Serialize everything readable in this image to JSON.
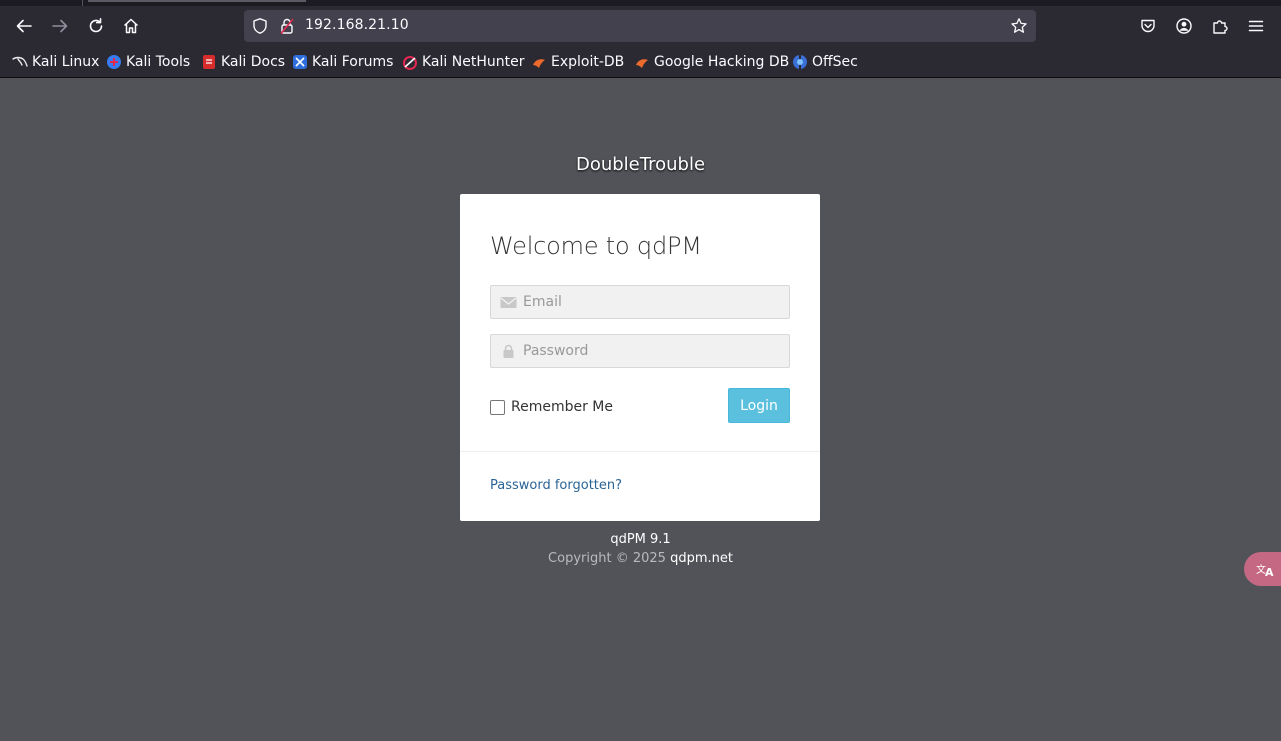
{
  "browser": {
    "url": "192.168.21.10",
    "bookmarks": [
      {
        "label": "Kali Linux",
        "icon": "kali-dragon-icon"
      },
      {
        "label": "Kali Tools",
        "icon": "kali-tools-icon"
      },
      {
        "label": "Kali Docs",
        "icon": "kali-docs-icon"
      },
      {
        "label": "Kali Forums",
        "icon": "kali-forums-icon"
      },
      {
        "label": "Kali NetHunter",
        "icon": "kali-nethunter-icon"
      },
      {
        "label": "Exploit-DB",
        "icon": "exploit-db-icon"
      },
      {
        "label": "Google Hacking DB",
        "icon": "ghdb-icon"
      },
      {
        "label": "OffSec",
        "icon": "offsec-icon"
      }
    ]
  },
  "page": {
    "brand": "DoubleTrouble",
    "card": {
      "title": "Welcome to qdPM",
      "email_placeholder": "Email",
      "password_placeholder": "Password",
      "remember_label": "Remember Me",
      "login_label": "Login",
      "forgot_label": "Password forgotten?"
    },
    "footer": {
      "version": "qdPM 9.1",
      "copyright": "Copyright © 2025",
      "site_link": "qdpm.net"
    }
  },
  "colors": {
    "page_bg": "#525359",
    "login_button": "#5bc0de",
    "link": "#2a6496",
    "translate_fab": "#c56883"
  }
}
